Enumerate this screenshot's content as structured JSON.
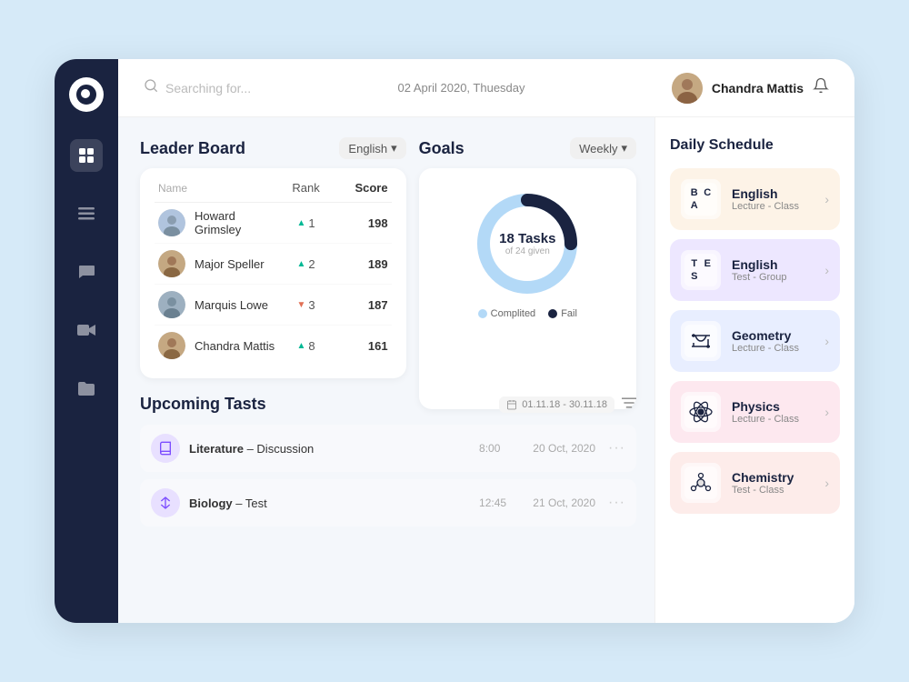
{
  "header": {
    "search_placeholder": "Searching for...",
    "date": "02 April 2020, Thuesday",
    "user_name": "Chandra Mattis"
  },
  "sidebar": {
    "logo_alt": "App Logo",
    "nav_items": [
      {
        "id": "grid",
        "icon": "grid",
        "active": true
      },
      {
        "id": "menu",
        "icon": "menu",
        "active": false
      },
      {
        "id": "chat",
        "icon": "chat",
        "active": false
      },
      {
        "id": "video",
        "icon": "video",
        "active": false
      },
      {
        "id": "folder",
        "icon": "folder",
        "active": false
      }
    ]
  },
  "leaderboard": {
    "title": "Leader Board",
    "filter": "English",
    "columns": {
      "name": "Name",
      "rank": "Rank",
      "score": "Score"
    },
    "rows": [
      {
        "name": "Howard Grimsley",
        "rank": 1,
        "score": 198,
        "trend": "up"
      },
      {
        "name": "Major Speller",
        "rank": 2,
        "score": 189,
        "trend": "up"
      },
      {
        "name": "Marquis Lowe",
        "rank": 3,
        "score": 187,
        "trend": "down"
      },
      {
        "name": "Chandra Mattis",
        "rank": 8,
        "score": 161,
        "trend": "up"
      }
    ]
  },
  "goals": {
    "title": "Goals",
    "filter": "Weekly",
    "tasks_done": 18,
    "tasks_total": 24,
    "label": "Tasks",
    "sublabel": "of 24 given",
    "legend": [
      {
        "label": "Complited",
        "color": "#b3d9f7"
      },
      {
        "label": "Fail",
        "color": "#1a2340"
      }
    ],
    "donut": {
      "completed_pct": 75,
      "fail_pct": 25
    }
  },
  "upcoming": {
    "title": "Upcoming Tasts",
    "date_range": "01.11.18 - 30.11.18",
    "tasks": [
      {
        "name": "Literature",
        "type": "Discussion",
        "time": "8:00",
        "date": "20 Oct, 2020",
        "icon": "book"
      },
      {
        "name": "Biology",
        "type": "Test",
        "time": "12:45",
        "date": "21 Oct, 2020",
        "icon": "pencil"
      }
    ]
  },
  "schedule": {
    "title": "Daily Schedule",
    "items": [
      {
        "subject": "English",
        "type": "Lecture - Class",
        "color": "beige",
        "icon_type": "letters"
      },
      {
        "subject": "English",
        "type": "Test - Group",
        "color": "purple",
        "icon_type": "letters_te"
      },
      {
        "subject": "Geometry",
        "type": "Lecture - Class",
        "color": "lavender",
        "icon_type": "graph"
      },
      {
        "subject": "Physics",
        "type": "Lecture - Class",
        "color": "pink",
        "icon_type": "atom"
      },
      {
        "subject": "Chemistry",
        "type": "Test - Class",
        "color": "peach",
        "icon_type": "molecule"
      }
    ]
  }
}
